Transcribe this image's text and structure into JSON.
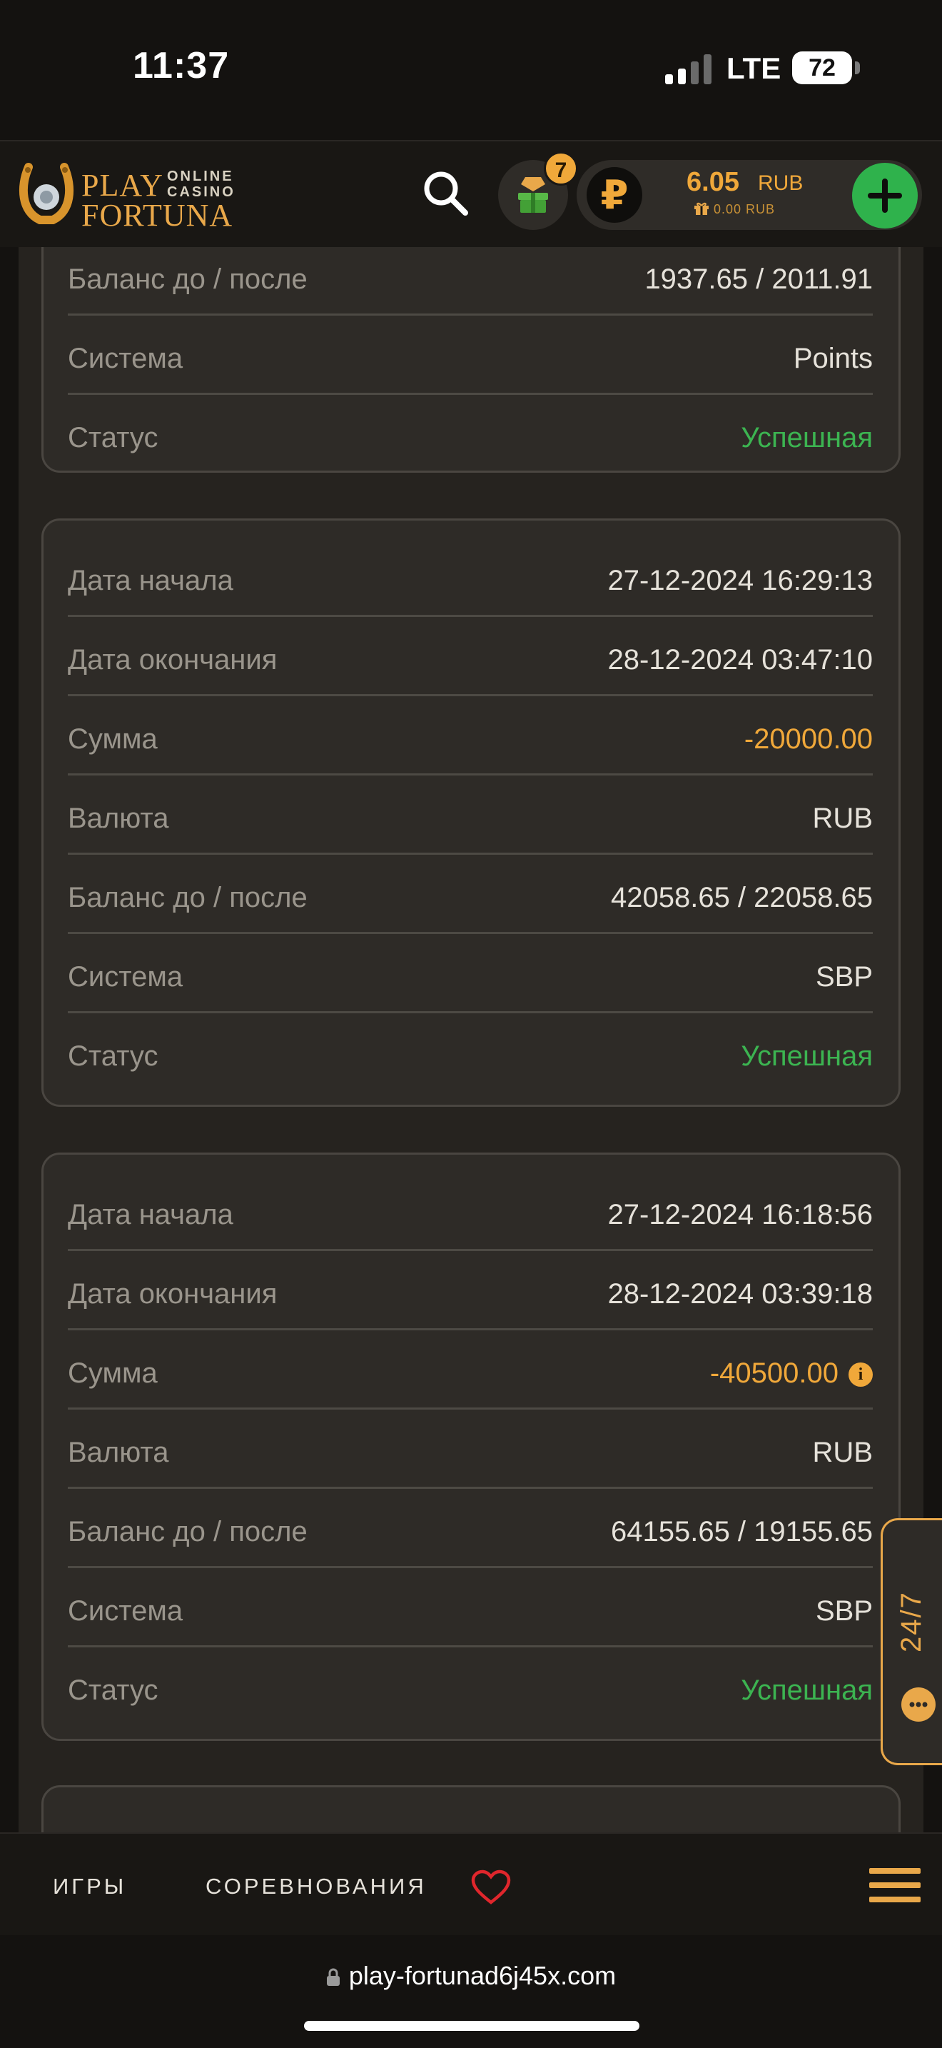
{
  "status_bar": {
    "time": "11:37",
    "network": "LTE",
    "battery": "72"
  },
  "header": {
    "logo": {
      "line1": "PLAY",
      "line2": "FORTUNA",
      "tag1": "ONLINE",
      "tag2": "CASINO"
    },
    "gifts_badge": "7",
    "balance": {
      "amount": "6.05",
      "currency": "RUB",
      "bonus": "0.00 RUB"
    },
    "accent_color": "#f0a83a",
    "add_color": "#2fb24c"
  },
  "cards": [
    {
      "rows": [
        {
          "label": "Баланс до / после",
          "value": "1937.65 / 2011.91",
          "kind": "normal"
        },
        {
          "label": "Система",
          "value": "Points",
          "kind": "normal"
        },
        {
          "label": "Статус",
          "value": "Успешная",
          "kind": "success"
        }
      ]
    },
    {
      "rows": [
        {
          "label": "Дата начала",
          "value": "27-12-2024 16:29:13",
          "kind": "normal"
        },
        {
          "label": "Дата окончания",
          "value": "28-12-2024 03:47:10",
          "kind": "normal"
        },
        {
          "label": "Сумма",
          "value": "-20000.00",
          "kind": "amount"
        },
        {
          "label": "Валюта",
          "value": "RUB",
          "kind": "normal"
        },
        {
          "label": "Баланс до / после",
          "value": "42058.65 / 22058.65",
          "kind": "normal"
        },
        {
          "label": "Система",
          "value": "SBP",
          "kind": "normal"
        },
        {
          "label": "Статус",
          "value": "Успешная",
          "kind": "success"
        }
      ]
    },
    {
      "rows": [
        {
          "label": "Дата начала",
          "value": "27-12-2024 16:18:56",
          "kind": "normal"
        },
        {
          "label": "Дата окончания",
          "value": "28-12-2024 03:39:18",
          "kind": "normal"
        },
        {
          "label": "Сумма",
          "value": "-40500.00",
          "kind": "amount",
          "info": true
        },
        {
          "label": "Валюта",
          "value": "RUB",
          "kind": "normal"
        },
        {
          "label": "Баланс до / после",
          "value": "64155.65 / 19155.65",
          "kind": "normal"
        },
        {
          "label": "Система",
          "value": "SBP",
          "kind": "normal"
        },
        {
          "label": "Статус",
          "value": "Успешная",
          "kind": "success"
        }
      ]
    }
  ],
  "support": {
    "label": "24/7"
  },
  "bottom_nav": {
    "games": "ИГРЫ",
    "competitions": "СОРЕВНОВАНИЯ"
  },
  "browser": {
    "url": "play-fortunad6j45x.com"
  }
}
